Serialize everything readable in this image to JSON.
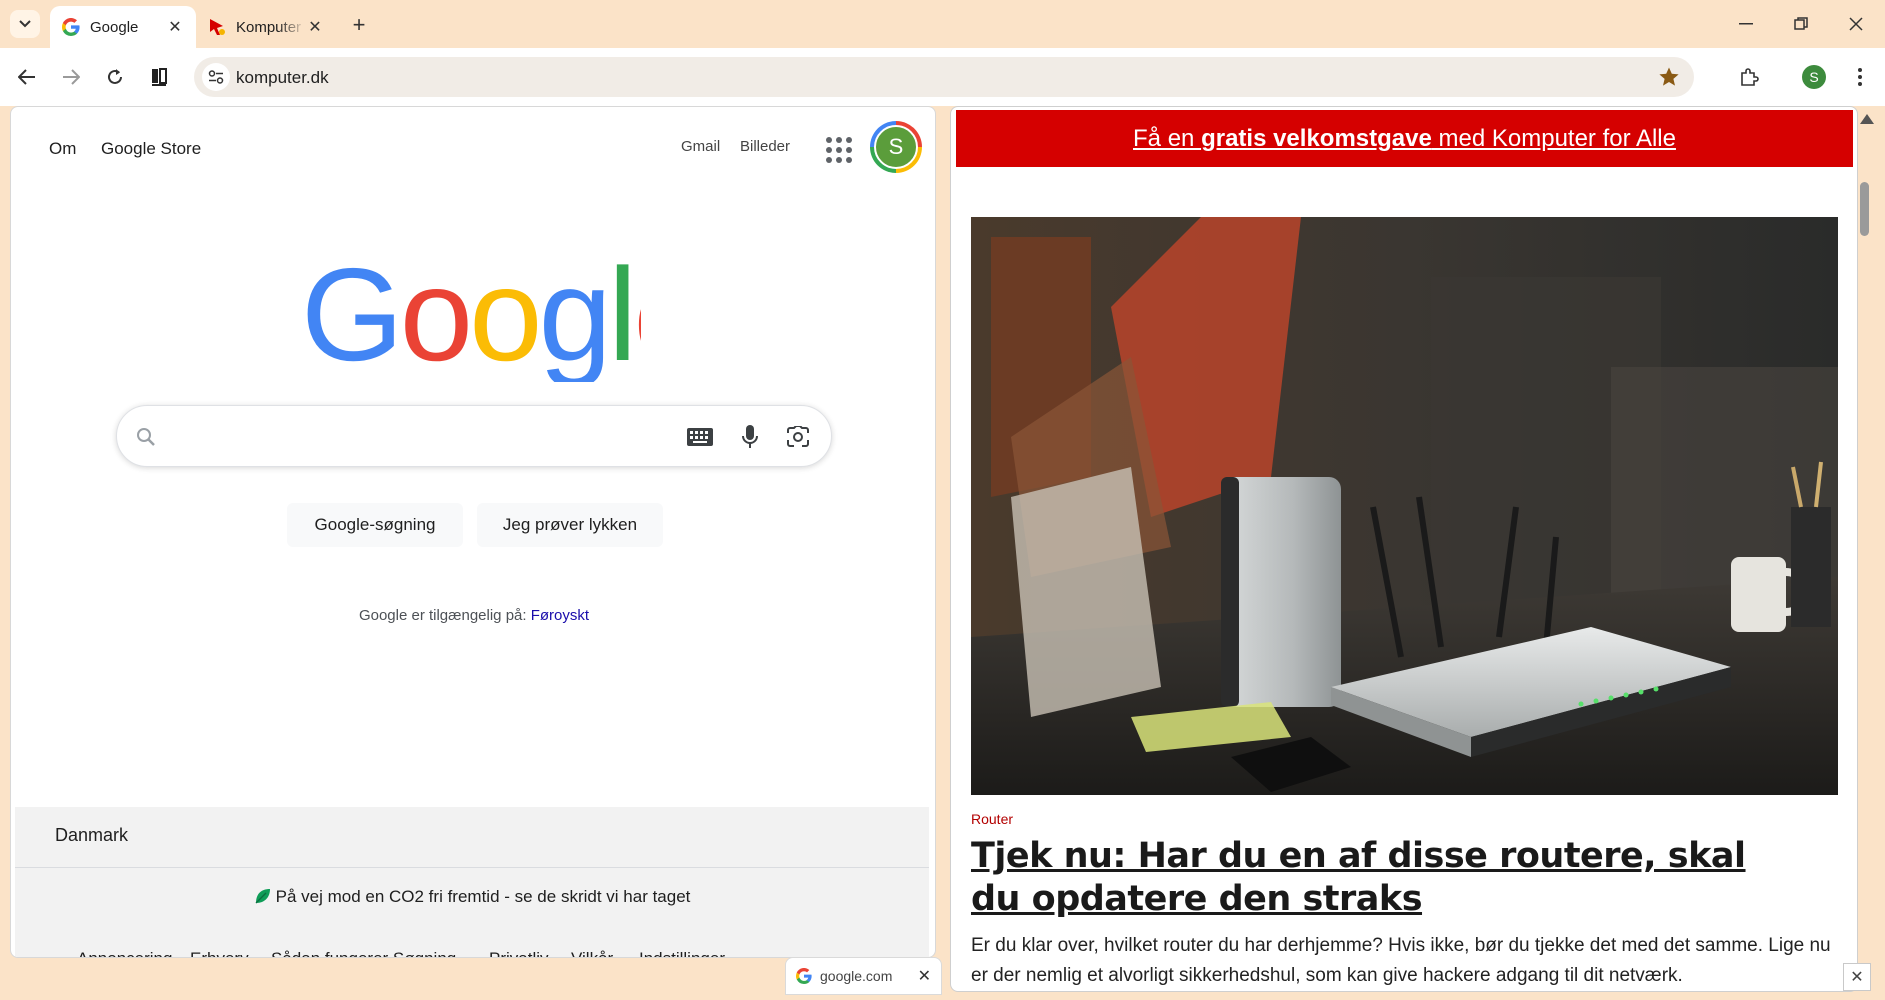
{
  "browser": {
    "tabs": [
      {
        "title": "Google",
        "favicon": "google-g-icon",
        "active": true
      },
      {
        "title": "Komputer",
        "favicon": "komputer-icon",
        "active": false
      }
    ],
    "new_tab": "+",
    "window_controls": {
      "minimize": "minimize-icon",
      "restore": "restore-icon",
      "close": "close-icon"
    },
    "omnibox_url": "komputer.dk",
    "profile_initial": "S"
  },
  "google": {
    "top_links": {
      "about": "Om",
      "store": "Google Store",
      "gmail": "Gmail",
      "images": "Billeder"
    },
    "avatar_initial": "S",
    "logo_text": "Google",
    "buttons": {
      "search": "Google-søgning",
      "lucky": "Jeg prøver lykken"
    },
    "offered_in": {
      "prefix": "Google er tilgængelig på:",
      "language": "Føroyskt"
    },
    "footer": {
      "country": "Danmark",
      "co2": "På vej mod en CO2 fri fremtid - se de skridt vi har taget",
      "links": [
        "Annoncering",
        "Erhverv",
        "Sådan fungerer Søgning",
        "Privatliv",
        "Vilkår",
        "Indstillinger"
      ]
    }
  },
  "komputer": {
    "banner": {
      "pre": "Få en ",
      "bold": "gratis velkomstgave",
      "post": " med Komputer for Alle"
    },
    "article": {
      "tag": "Router",
      "title": "Tjek nu: Har du en af disse routere, skal du opdatere den straks",
      "excerpt": "Er du klar over, hvilket router du har derhjemme? Hvis ikke, bør du tjekke det med det samme. Lige nu er der nemlig et alvorligt sikkerhedshul, som kan give hackere adgang til dit netværk."
    }
  },
  "status_bubble": {
    "url": "google.com",
    "close": "✕"
  },
  "colors": {
    "banner_red": "#d50000",
    "tag_red": "#b30000",
    "chrome_frame": "#fbe3c8",
    "link_blue": "#1a0dab",
    "star_gold": "#8a5a14"
  }
}
